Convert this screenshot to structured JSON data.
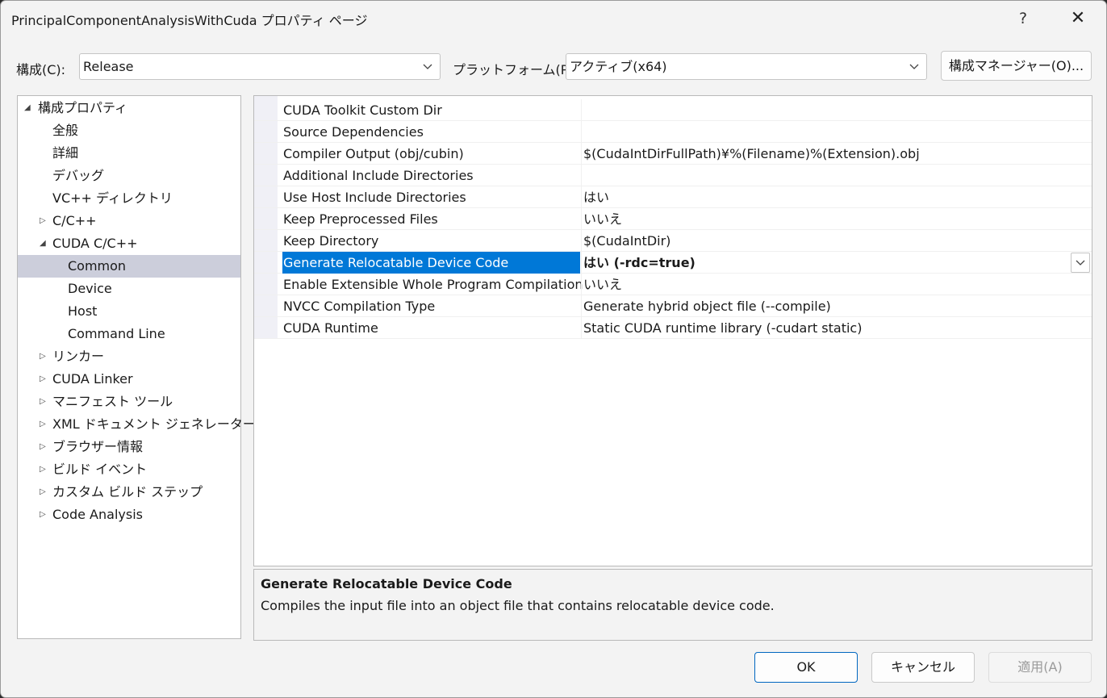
{
  "window": {
    "title": "PrincipalComponentAnalysisWithCuda プロパティ ページ",
    "help_label": "?",
    "close_label": "✕"
  },
  "toolbar": {
    "config_label": "構成(C):",
    "config_value": "Release",
    "platform_label": "プラットフォーム(P):",
    "platform_value": "アクティブ(x64)",
    "config_manager_label": "構成マネージャー(O)..."
  },
  "tree": {
    "items": [
      {
        "label": "構成プロパティ",
        "level": 0,
        "expander": "expanded"
      },
      {
        "label": "全般",
        "level": 1,
        "expander": "none"
      },
      {
        "label": "詳細",
        "level": 1,
        "expander": "none"
      },
      {
        "label": "デバッグ",
        "level": 1,
        "expander": "none"
      },
      {
        "label": "VC++ ディレクトリ",
        "level": 1,
        "expander": "none"
      },
      {
        "label": "C/C++",
        "level": 1,
        "expander": "collapsed"
      },
      {
        "label": "CUDA C/C++",
        "level": 1,
        "expander": "expanded"
      },
      {
        "label": "Common",
        "level": 2,
        "expander": "none",
        "selected": true
      },
      {
        "label": "Device",
        "level": 2,
        "expander": "none"
      },
      {
        "label": "Host",
        "level": 2,
        "expander": "none"
      },
      {
        "label": "Command Line",
        "level": 2,
        "expander": "none"
      },
      {
        "label": "リンカー",
        "level": 1,
        "expander": "collapsed"
      },
      {
        "label": "CUDA Linker",
        "level": 1,
        "expander": "collapsed"
      },
      {
        "label": "マニフェスト ツール",
        "level": 1,
        "expander": "collapsed"
      },
      {
        "label": "XML ドキュメント ジェネレーター",
        "level": 1,
        "expander": "collapsed"
      },
      {
        "label": "ブラウザー情報",
        "level": 1,
        "expander": "collapsed"
      },
      {
        "label": "ビルド イベント",
        "level": 1,
        "expander": "collapsed"
      },
      {
        "label": "カスタム ビルド ステップ",
        "level": 1,
        "expander": "collapsed"
      },
      {
        "label": "Code Analysis",
        "level": 1,
        "expander": "collapsed"
      }
    ]
  },
  "properties": {
    "rows": [
      {
        "name": "CUDA Toolkit Custom Dir",
        "value": ""
      },
      {
        "name": "Source Dependencies",
        "value": ""
      },
      {
        "name": "Compiler Output (obj/cubin)",
        "value": "$(CudaIntDirFullPath)¥%(Filename)%(Extension).obj"
      },
      {
        "name": "Additional Include Directories",
        "value": ""
      },
      {
        "name": "Use Host Include Directories",
        "value": "はい"
      },
      {
        "name": "Keep Preprocessed Files",
        "value": "いいえ"
      },
      {
        "name": "Keep Directory",
        "value": "$(CudaIntDir)"
      },
      {
        "name": "Generate Relocatable Device Code",
        "value": "はい (-rdc=true)",
        "selected": true
      },
      {
        "name": "Enable Extensible Whole Program Compilation",
        "value": "いいえ"
      },
      {
        "name": "NVCC Compilation Type",
        "value": "Generate hybrid object file (--compile)"
      },
      {
        "name": "CUDA Runtime",
        "value": "Static CUDA runtime library (-cudart static)"
      }
    ]
  },
  "description": {
    "title": "Generate Relocatable Device Code",
    "text": "Compiles the input file into an object file that contains relocatable device code."
  },
  "buttons": {
    "ok": "OK",
    "cancel": "キャンセル",
    "apply": "適用(A)"
  },
  "colors": {
    "selection": "#0078d7",
    "tree_selection": "#cccedb",
    "dialog_bg": "#f3f3f3"
  }
}
